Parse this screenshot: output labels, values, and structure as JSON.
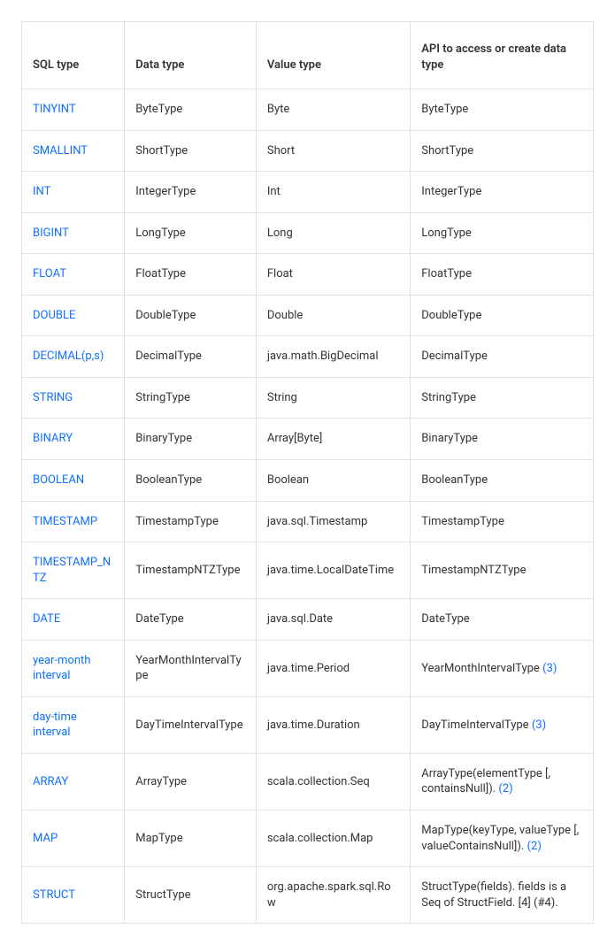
{
  "headers": {
    "sql": "SQL type",
    "data": "Data type",
    "value": "Value type",
    "api": "API to access or create data type"
  },
  "rows": [
    {
      "sql": "TINYINT",
      "data": "ByteType",
      "value": "Byte",
      "api": "ByteType",
      "api_note": ""
    },
    {
      "sql": "SMALLINT",
      "data": "ShortType",
      "value": "Short",
      "api": "ShortType",
      "api_note": ""
    },
    {
      "sql": "INT",
      "data": "IntegerType",
      "value": "Int",
      "api": "IntegerType",
      "api_note": ""
    },
    {
      "sql": "BIGINT",
      "data": "LongType",
      "value": "Long",
      "api": "LongType",
      "api_note": ""
    },
    {
      "sql": "FLOAT",
      "data": "FloatType",
      "value": "Float",
      "api": "FloatType",
      "api_note": ""
    },
    {
      "sql": "DOUBLE",
      "data": "DoubleType",
      "value": "Double",
      "api": "DoubleType",
      "api_note": ""
    },
    {
      "sql": "DECIMAL(p,s)",
      "data": "DecimalType",
      "value": "java.math.BigDecimal",
      "api": "DecimalType",
      "api_note": ""
    },
    {
      "sql": "STRING",
      "data": "StringType",
      "value": "String",
      "api": "StringType",
      "api_note": ""
    },
    {
      "sql": "BINARY",
      "data": "BinaryType",
      "value": "Array[Byte]",
      "api": "BinaryType",
      "api_note": ""
    },
    {
      "sql": "BOOLEAN",
      "data": "BooleanType",
      "value": "Boolean",
      "api": "BooleanType",
      "api_note": ""
    },
    {
      "sql": "TIMESTAMP",
      "data": "TimestampType",
      "value": "java.sql.Timestamp",
      "api": "TimestampType",
      "api_note": ""
    },
    {
      "sql": "TIMESTAMP_NTZ",
      "data": "TimestampNTZType",
      "value": "java.time.LocalDateTime",
      "api": "TimestampNTZType",
      "api_note": ""
    },
    {
      "sql": "DATE",
      "data": "DateType",
      "value": "java.sql.Date",
      "api": "DateType",
      "api_note": ""
    },
    {
      "sql": "year-month interval",
      "data": "YearMonthIntervalType",
      "value": "java.time.Period",
      "api": "YearMonthIntervalType ",
      "api_note": "(3)"
    },
    {
      "sql": "day-time interval",
      "data": "DayTimeIntervalType",
      "value": "java.time.Duration",
      "api": "DayTimeIntervalType ",
      "api_note": "(3)"
    },
    {
      "sql": "ARRAY",
      "data": "ArrayType",
      "value": "scala.collection.Seq",
      "api": "ArrayType(elementType [, containsNull]). ",
      "api_note": "(2)"
    },
    {
      "sql": "MAP",
      "data": "MapType",
      "value": "scala.collection.Map",
      "api": "MapType(keyType, valueType [, valueContainsNull]). ",
      "api_note": "(2)"
    },
    {
      "sql": "STRUCT",
      "data": "StructType",
      "value": "org.apache.spark.sql.Row",
      "api": "StructType(fields). fields is a Seq of StructField. [4] (#4).",
      "api_note": ""
    }
  ]
}
